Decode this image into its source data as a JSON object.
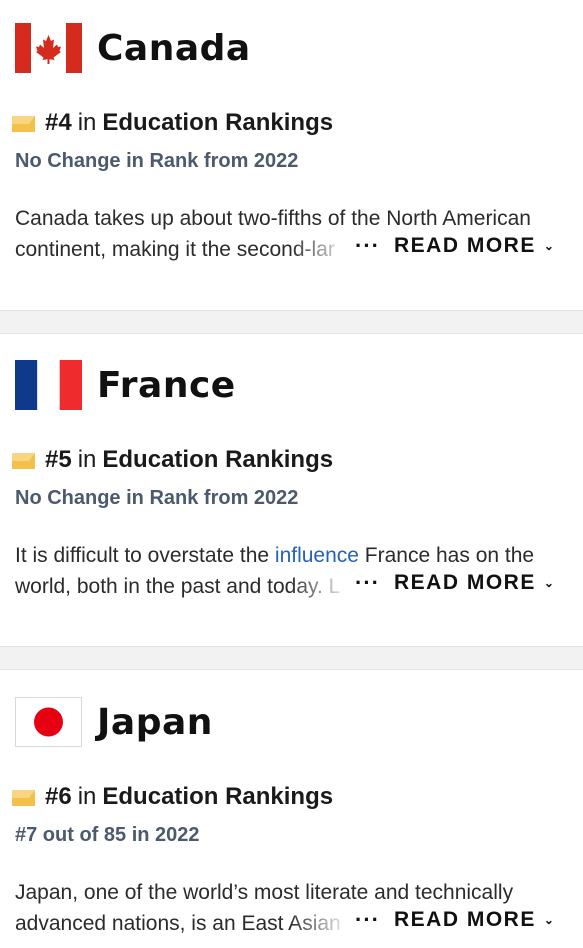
{
  "countries": [
    {
      "name": "Canada",
      "flag": "canada-flag-icon",
      "rank_num": "#4",
      "rank_in": "in",
      "rank_category": "Education Rankings",
      "change_text": "No Change in Rank from 2022",
      "desc_line1": "Canada takes up about two-fifths of the North American",
      "desc_line2_pre": "continent, making it the second-lar",
      "desc_line2_link": "",
      "desc_line2_post": "",
      "ellipsis": "···",
      "read_more": "READ MORE",
      "chevron": "⌄"
    },
    {
      "name": "France",
      "flag": "france-flag-icon",
      "rank_num": "#5",
      "rank_in": "in",
      "rank_category": "Education Rankings",
      "change_text": "No Change in Rank from 2022",
      "desc_line1_pre": "It is difficult to overstate the ",
      "desc_line1_link": "influence",
      "desc_line1_post": " France has on the",
      "desc_line2_pre": "world, both in the past and today. L",
      "ellipsis": "···",
      "read_more": "READ MORE",
      "chevron": "⌄"
    },
    {
      "name": "Japan",
      "flag": "japan-flag-icon",
      "rank_num": "#6",
      "rank_in": "in",
      "rank_category": "Education Rankings",
      "change_text": "#7 out of 85 in 2022",
      "desc_line1": "Japan, one of the world’s most literate and technically",
      "desc_line2_pre": "advanced nations, is an East Asian",
      "ellipsis": "···",
      "read_more": "READ MORE",
      "chevron": "⌄"
    }
  ],
  "colors": {
    "canada_red": "#d52b1e",
    "france_blue": "#0f3a8c",
    "france_red": "#ef2b2d",
    "japan_red": "#e60012",
    "badge_yellow": "#f5c04a",
    "link_blue": "#2563b8",
    "change_gray": "#4c5a6e"
  }
}
